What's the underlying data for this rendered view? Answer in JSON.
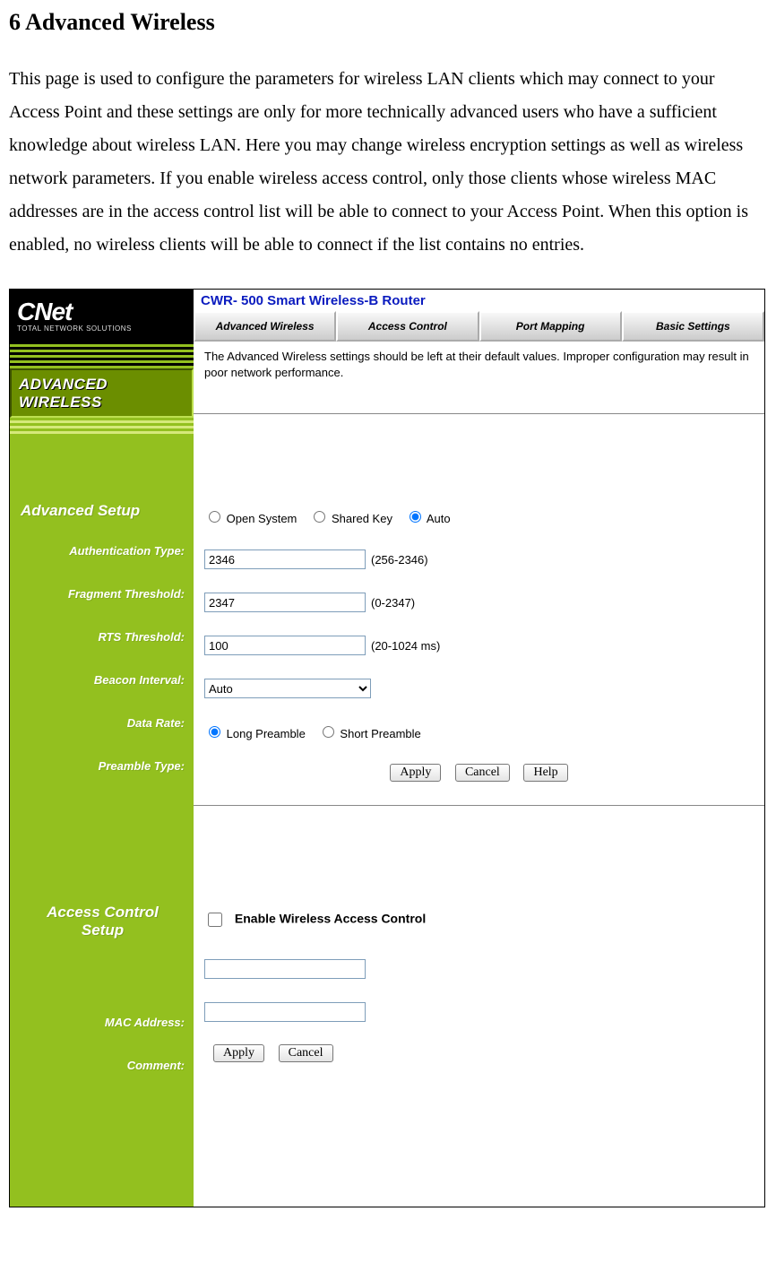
{
  "doc": {
    "heading": "6    Advanced Wireless",
    "body": "This page is used to configure the parameters for wireless LAN clients which may connect to your Access Point and these settings are only for more technically advanced users who have a sufficient knowledge about wireless LAN. Here you may change wireless encryption settings as well as wireless network parameters. If you enable wireless access control, only those clients whose wireless MAC addresses are in the access control list will be able to connect to your Access Point. When this option is enabled, no wireless clients will be able to connect if the list contains no entries."
  },
  "ui": {
    "logo_main": "CNet",
    "logo_sub": "TOTAL NETWORK SOLUTIONS",
    "product": "CWR- 500 Smart Wireless-B Router",
    "tabs": [
      "Advanced\nWireless",
      "Access\nControl",
      "Port\nMapping",
      "Basic\nSettings"
    ],
    "page_badge": "ADVANCED WIRELESS",
    "desc": "The Advanced Wireless settings should be left at their default values. Improper configuration may result in poor network performance.",
    "sections": {
      "advanced_setup": "Advanced Setup",
      "access_control_setup": "Access Control\nSetup"
    },
    "labels": {
      "auth_type": "Authentication Type:",
      "fragment": "Fragment Threshold:",
      "rts": "RTS Threshold:",
      "beacon": "Beacon Interval:",
      "data_rate": "Data Rate:",
      "preamble": "Preamble Type:",
      "mac": "MAC Address:",
      "comment": "Comment:"
    },
    "auth_options": {
      "open": "Open System",
      "shared": "Shared Key",
      "auto": "Auto"
    },
    "fragment_value": "2346",
    "fragment_hint": "(256-2346)",
    "rts_value": "2347",
    "rts_hint": "(0-2347)",
    "beacon_value": "100",
    "beacon_hint": "(20-1024 ms)",
    "data_rate_value": "Auto",
    "preamble_options": {
      "long": "Long Preamble",
      "short": "Short Preamble"
    },
    "buttons": {
      "apply": "Apply",
      "cancel": "Cancel",
      "help": "Help"
    },
    "enable_ac_label": "Enable Wireless Access Control",
    "mac_value": "",
    "comment_value": ""
  }
}
